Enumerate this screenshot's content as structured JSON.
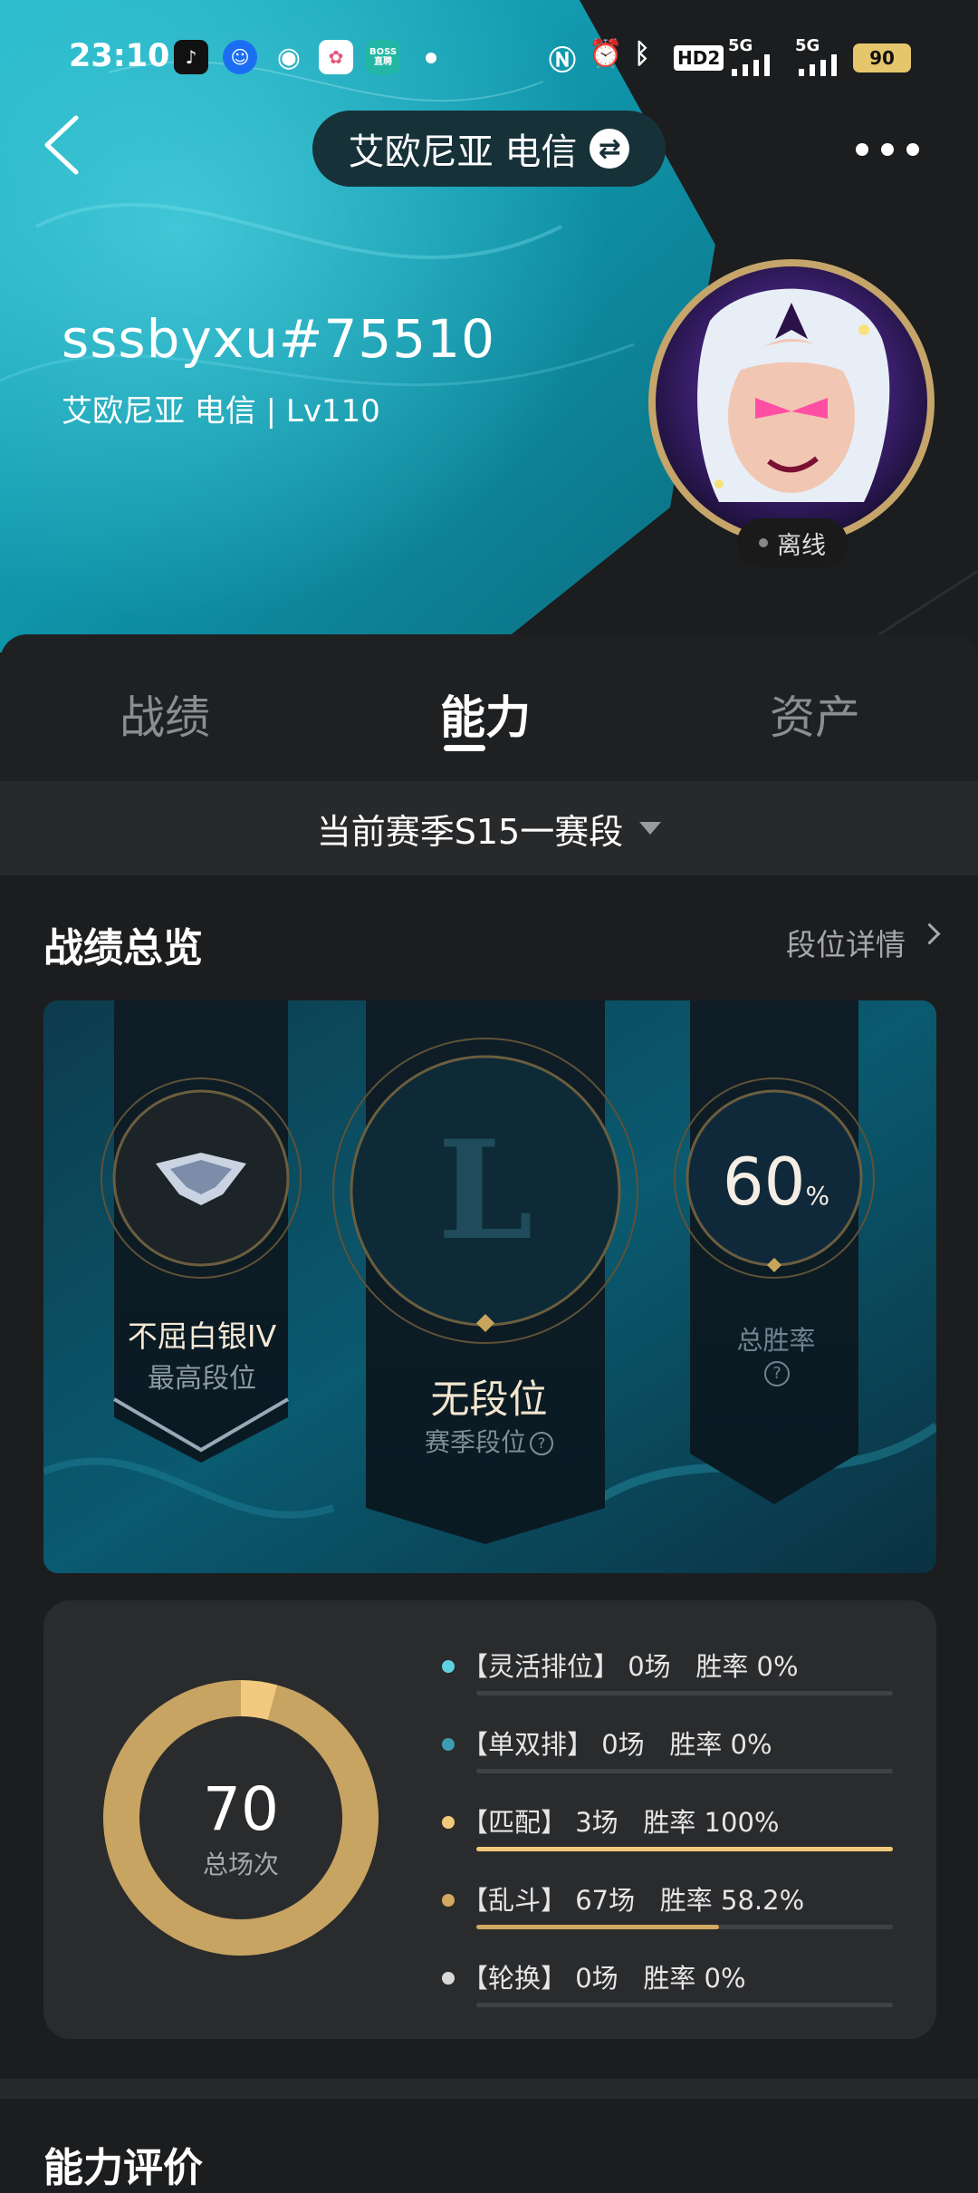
{
  "status_bar": {
    "time": "23:10",
    "apps": [
      "tiktok-icon",
      "qq-icon",
      "weibo-icon",
      "photos-icon",
      "boss-icon"
    ],
    "boss_label": "BOSS\n直聘",
    "hd_label": "HD2",
    "net1": "5G",
    "net2": "5G",
    "battery": "90"
  },
  "top_bar": {
    "server": "艾欧尼亚 电信"
  },
  "player": {
    "name": "sssbyxu#75510",
    "sub": "艾欧尼亚 电信 | Lv110",
    "status": "离线"
  },
  "tabs": [
    {
      "label": "战绩",
      "active": false
    },
    {
      "label": "能力",
      "active": true
    },
    {
      "label": "资产",
      "active": false
    }
  ],
  "season_selector": "当前赛季S15一赛段",
  "overview": {
    "title": "战绩总览",
    "detail_link": "段位详情"
  },
  "ranks": {
    "highest_rank": "不屈白银IV",
    "highest_label": "最高段位",
    "season_rank": "无段位",
    "season_label": "赛季段位",
    "win_rate_value": "60",
    "win_rate_unit": "%",
    "win_rate_label": "总胜率",
    "question": "?"
  },
  "stats": {
    "total_games": "70",
    "total_label": "总场次",
    "modes": [
      {
        "text": "【灵活排位】 0场   胜率 0%",
        "color": "#5fd0df",
        "win_rate": 0
      },
      {
        "text": "【单双排】 0场   胜率 0%",
        "color": "#3c9db2",
        "win_rate": 0
      },
      {
        "text": "【匹配】 3场   胜率 100%",
        "color": "#f2c87a",
        "win_rate": 1.0
      },
      {
        "text": "【乱斗】 67场   胜率 58.2%",
        "color": "#d2a85f",
        "win_rate": 0.582
      },
      {
        "text": "【轮换】 0场   胜率 0%",
        "color": "#d9d9d9",
        "win_rate": 0
      }
    ],
    "donut_segments": [
      {
        "games": 3,
        "color": "#f3c97f"
      },
      {
        "games": 67,
        "color": "#c8a462"
      }
    ]
  },
  "ability": {
    "title": "能力评价"
  }
}
